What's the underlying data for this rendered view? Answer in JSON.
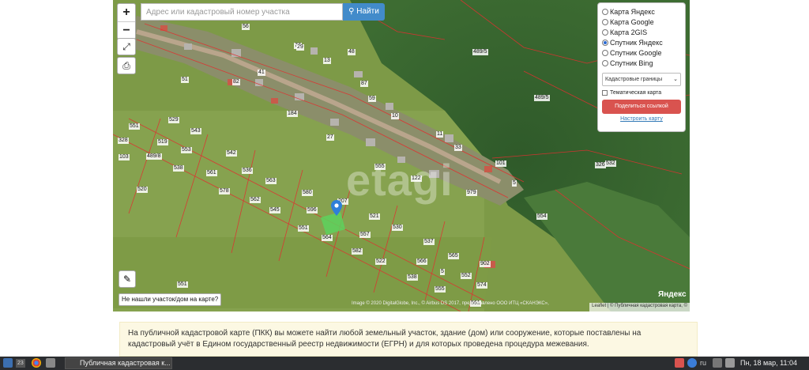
{
  "search": {
    "placeholder": "Адрес или кадастровый номер участка",
    "button_label": "Найти"
  },
  "zoom": {
    "in_label": "+",
    "out_label": "−"
  },
  "layers": {
    "options": [
      {
        "label": "Карта Яндекс",
        "selected": false
      },
      {
        "label": "Карта Google",
        "selected": false
      },
      {
        "label": "Карта 2GIS",
        "selected": false
      },
      {
        "label": "Спутник Яндекс",
        "selected": true
      },
      {
        "label": "Спутник Google",
        "selected": false
      },
      {
        "label": "Спутник Bing",
        "selected": false
      }
    ],
    "boundary_select": "Кадастровые границы",
    "thematic_label": "Тематическая карта",
    "share_label": "Поделиться ссылкой",
    "setup_label": "Настроить карту"
  },
  "not_found_label": "Не нашли участок/дом на карте?",
  "copyright": "Image © 2020 DigitalGlobe, Inc., © Airbus DS 2017, предоставлено ООО ИТЦ «СКАНЭКС»,",
  "attribution": "Leaflet | © Публичная кадастровая карта, ©",
  "yandex_logo": "Яндекс",
  "watermark": "etagi",
  "parcels": [
    "56",
    "77",
    "29",
    "13",
    "48",
    "489/5",
    "51",
    "82",
    "41",
    "87",
    "59",
    "489/5",
    "551",
    "529",
    "543",
    "184",
    "10",
    "11",
    "328",
    "519",
    "553",
    "27",
    "33",
    "326",
    "103",
    "489/8",
    "538",
    "542",
    "555",
    "122",
    "101",
    "5",
    "532",
    "520",
    "561",
    "536",
    "563",
    "580",
    "207",
    "979",
    "554",
    "578",
    "562",
    "545",
    "596",
    "521",
    "551",
    "557",
    "530",
    "564",
    "582",
    "537",
    "522",
    "566",
    "565",
    "538",
    "5",
    "902",
    "551",
    "555",
    "574",
    "561",
    "552"
  ],
  "info_text": "На публичной кадастровой карте (ПКК) вы можете найти любой земельный участок, здание (дом) или сооружение, которые поставлены на кадастровый учёт в Едином государственный реестр недвижимости (ЕГРН) и для которых проведена процедура межевания.",
  "taskbar": {
    "badge": "23",
    "window_title": "Публичная кадастровая к...",
    "lang": "ru",
    "clock": "Пн, 18 мар, 11:04"
  },
  "colors": {
    "search_button": "#428bca",
    "share_button": "#d9534f",
    "cadastral_line": "#e03030",
    "selected_parcel": "#5dd25d"
  }
}
